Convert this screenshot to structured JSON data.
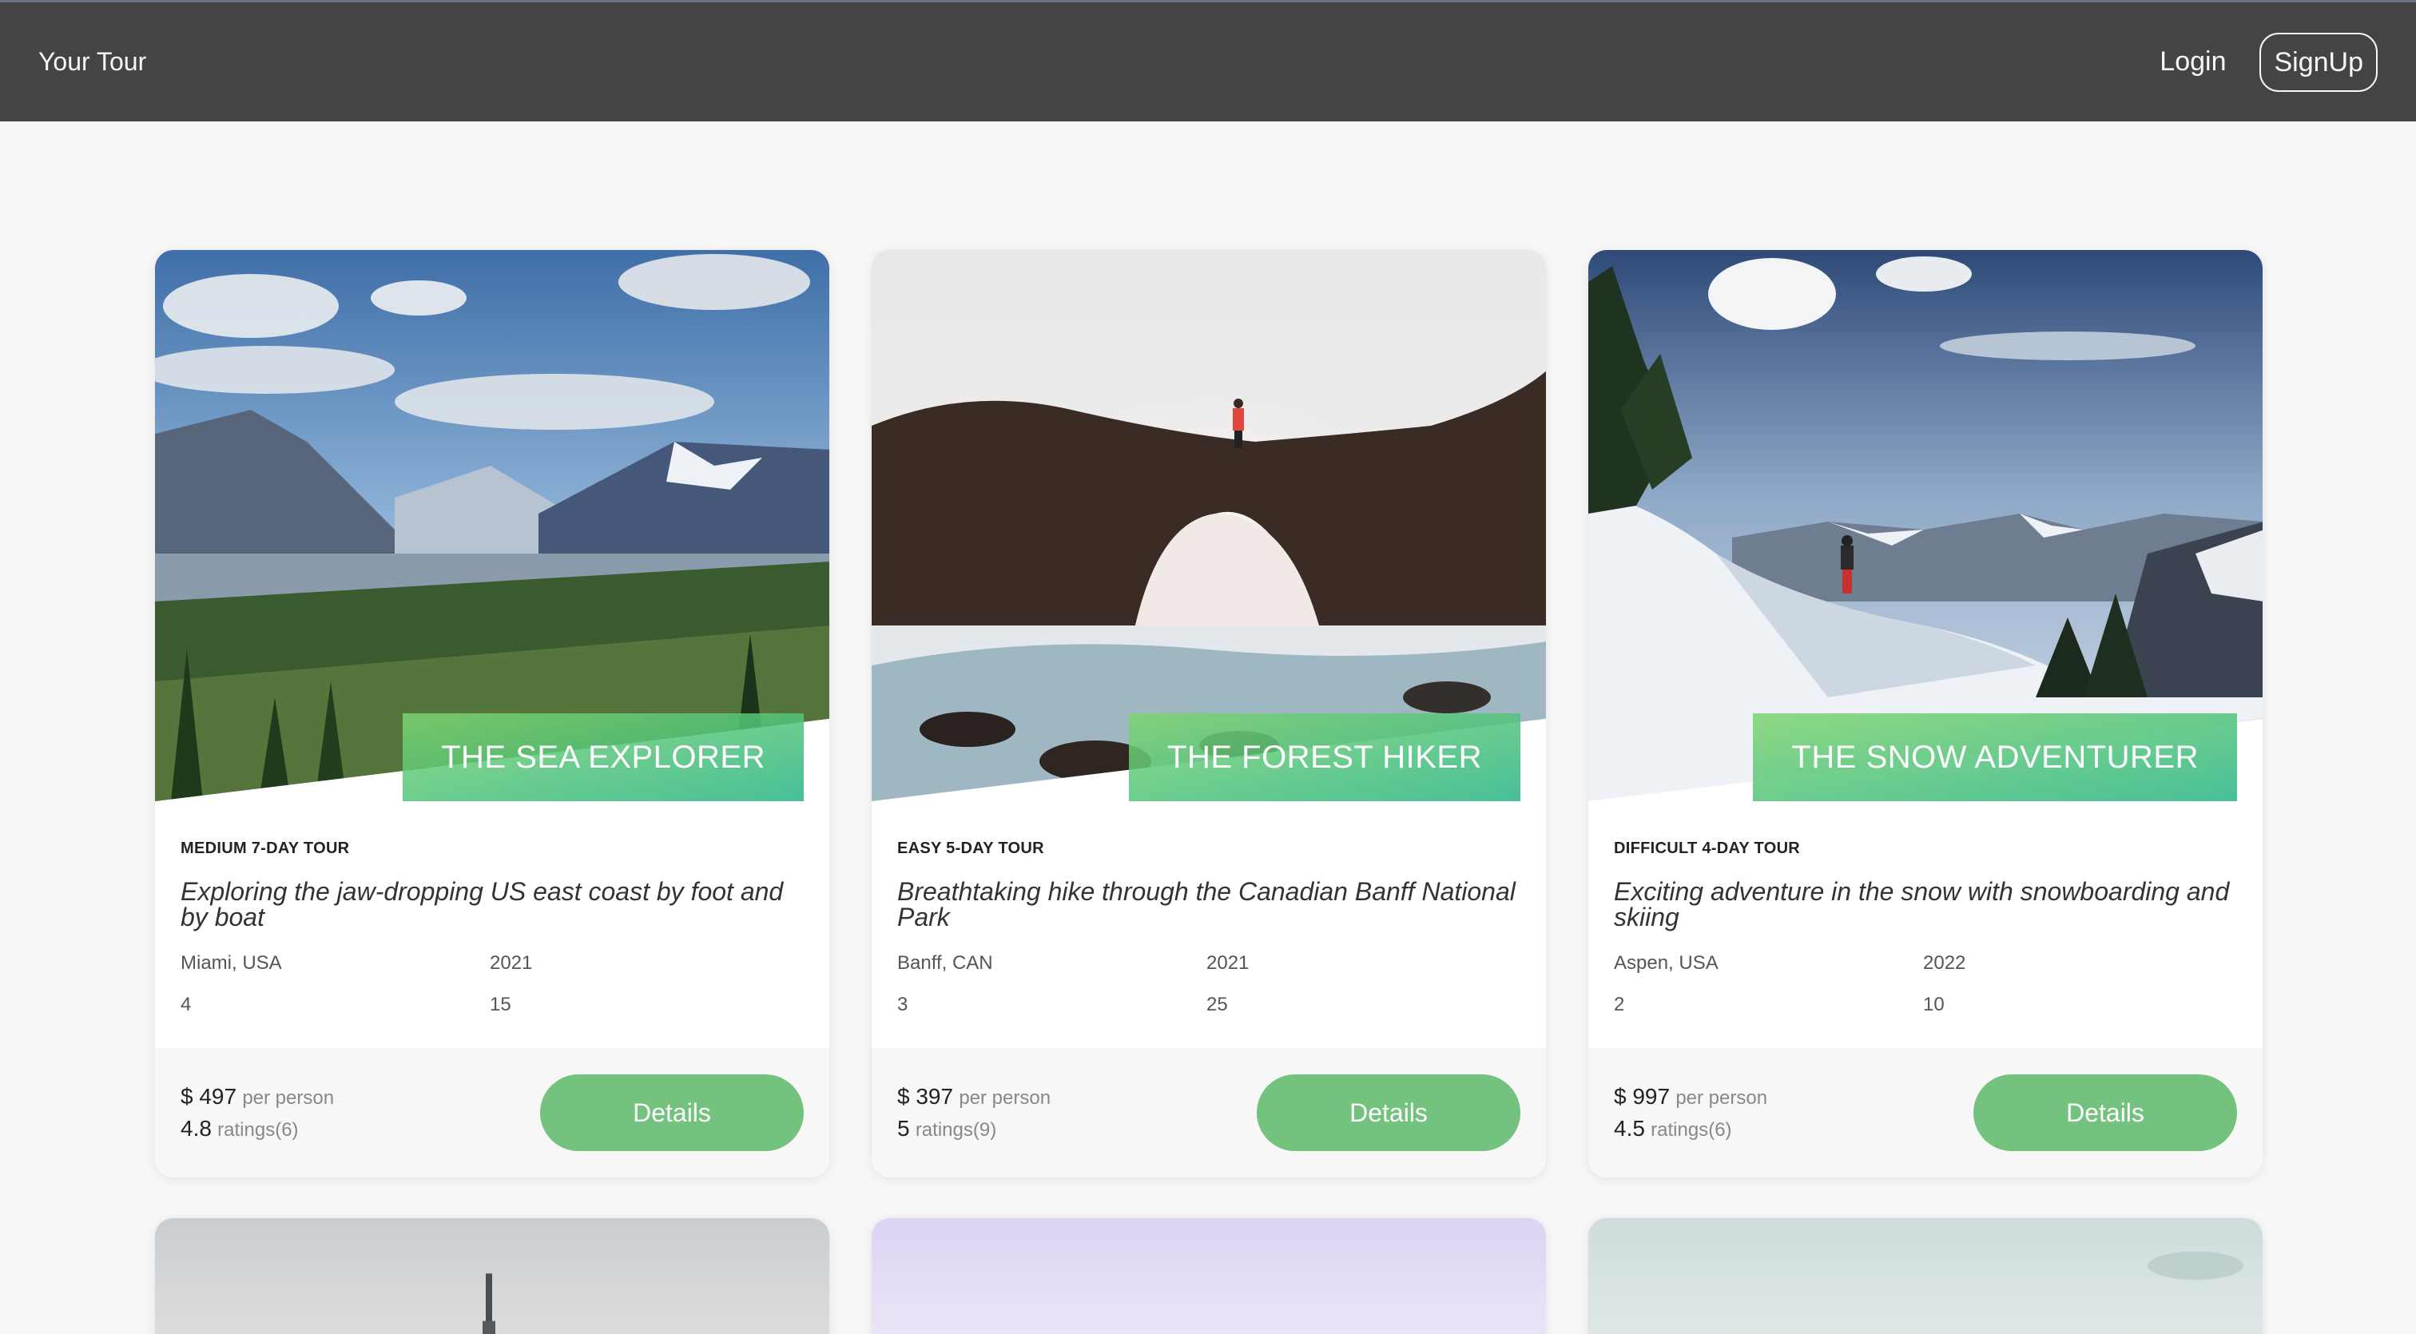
{
  "header": {
    "brand": "Your Tour",
    "login_label": "Login",
    "signup_label": "SignUp"
  },
  "colors": {
    "header_bg": "#444444",
    "accent_green": "#73c37f",
    "page_bg": "#f7f7f7"
  },
  "tours": [
    {
      "title": "The Sea Explorer",
      "subheading": "Medium 7-day tour",
      "summary": "Exploring the jaw-dropping US east coast by foot and by boat",
      "location": "Miami, USA",
      "year": "2021",
      "stat_a": "4",
      "stat_b": "15",
      "price": "$ 497",
      "price_label": "per person",
      "rating": "4.8",
      "ratings_label": "ratings(6)",
      "button_label": "Details",
      "image": "mountain-valley-forest-photo"
    },
    {
      "title": "The Forest Hiker",
      "subheading": "Easy 5-day tour",
      "summary": "Breathtaking hike through the Canadian Banff National Park",
      "location": "Banff, CAN",
      "year": "2021",
      "stat_a": "3",
      "stat_b": "25",
      "price": "$ 397",
      "price_label": "per person",
      "rating": "5",
      "ratings_label": "ratings(9)",
      "button_label": "Details",
      "image": "rock-arch-sea-photo"
    },
    {
      "title": "The Snow Adventurer",
      "subheading": "Difficult 4-day tour",
      "summary": "Exciting adventure in the snow with snowboarding and skiing",
      "location": "Aspen, USA",
      "year": "2022",
      "stat_a": "2",
      "stat_b": "10",
      "price": "$ 997",
      "price_label": "per person",
      "rating": "4.5",
      "ratings_label": "ratings(6)",
      "button_label": "Details",
      "image": "snowy-mountain-hiker-photo"
    }
  ]
}
